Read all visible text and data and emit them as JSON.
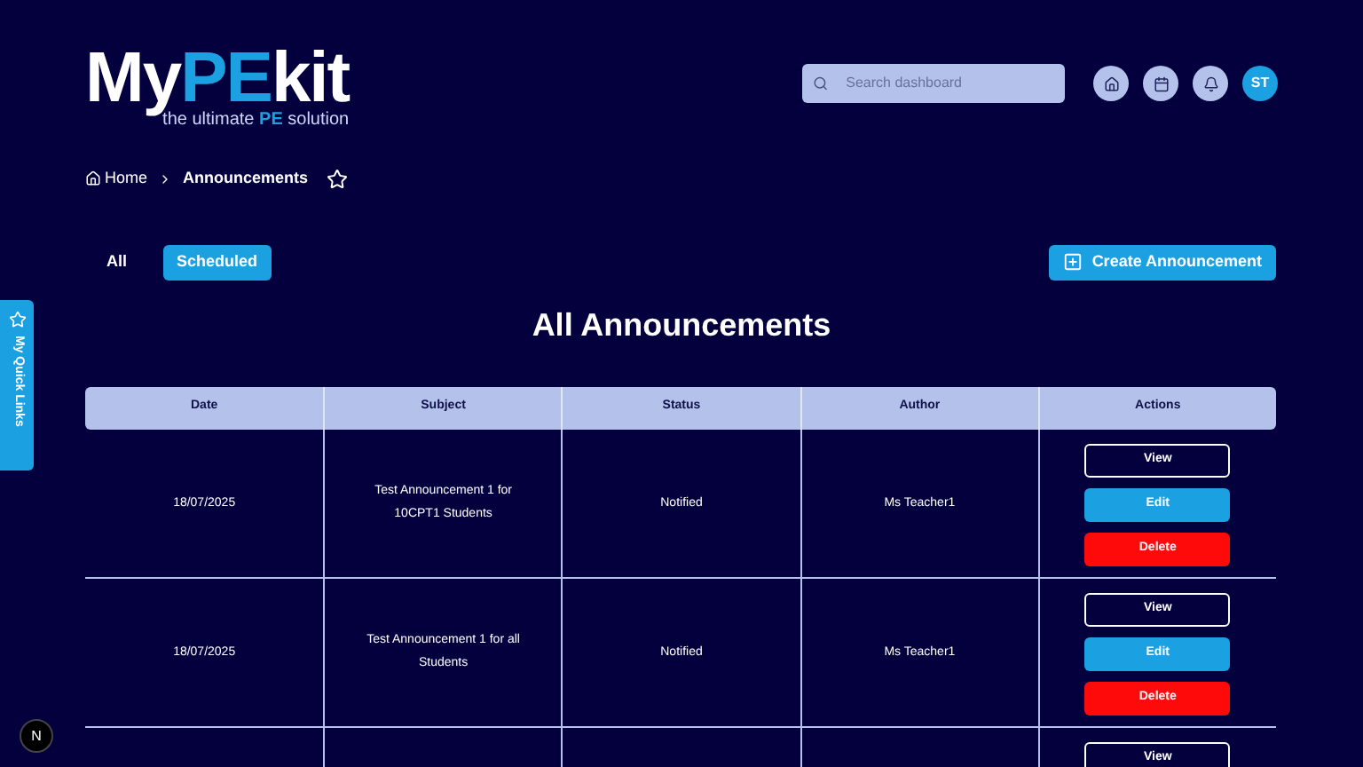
{
  "logo": {
    "prefix": "My",
    "highlight": "PE",
    "suffix": "kit",
    "tagline_prefix": "the ultimate ",
    "tagline_highlight": "PE",
    "tagline_suffix": " solution"
  },
  "search": {
    "placeholder": "Search dashboard"
  },
  "user": {
    "initials": "ST"
  },
  "breadcrumb": [
    {
      "label": "Home",
      "kind": "home"
    },
    {
      "label": "Announcements",
      "kind": "current"
    }
  ],
  "tabs": [
    {
      "label": "All",
      "selected": false
    },
    {
      "label": "Scheduled",
      "selected": true
    }
  ],
  "create_button": "Create Announcement",
  "title": "All Announcements",
  "quick_links": "My Quick Links",
  "table": {
    "columns": [
      "Date",
      "Subject",
      "Status",
      "Author",
      "Actions"
    ],
    "rows": [
      {
        "date": "18/07/2025",
        "subject": "Test Announcement 1 for 10CPT1 Students",
        "status": "Notified",
        "author": "Ms Teacher1",
        "actions": [
          {
            "label": "View",
            "kind": "outline"
          },
          {
            "label": "Edit",
            "kind": "primary"
          },
          {
            "label": "Delete",
            "kind": "danger"
          }
        ]
      },
      {
        "date": "18/07/2025",
        "subject": "Test Announcement 1 for all Students",
        "status": "Notified",
        "author": "Ms Teacher1",
        "actions": [
          {
            "label": "View",
            "kind": "outline"
          },
          {
            "label": "Edit",
            "kind": "primary"
          },
          {
            "label": "Delete",
            "kind": "danger"
          }
        ]
      },
      {
        "actions": [
          {
            "label": "View",
            "kind": "outline"
          }
        ]
      }
    ]
  },
  "dev_badge": "N"
}
